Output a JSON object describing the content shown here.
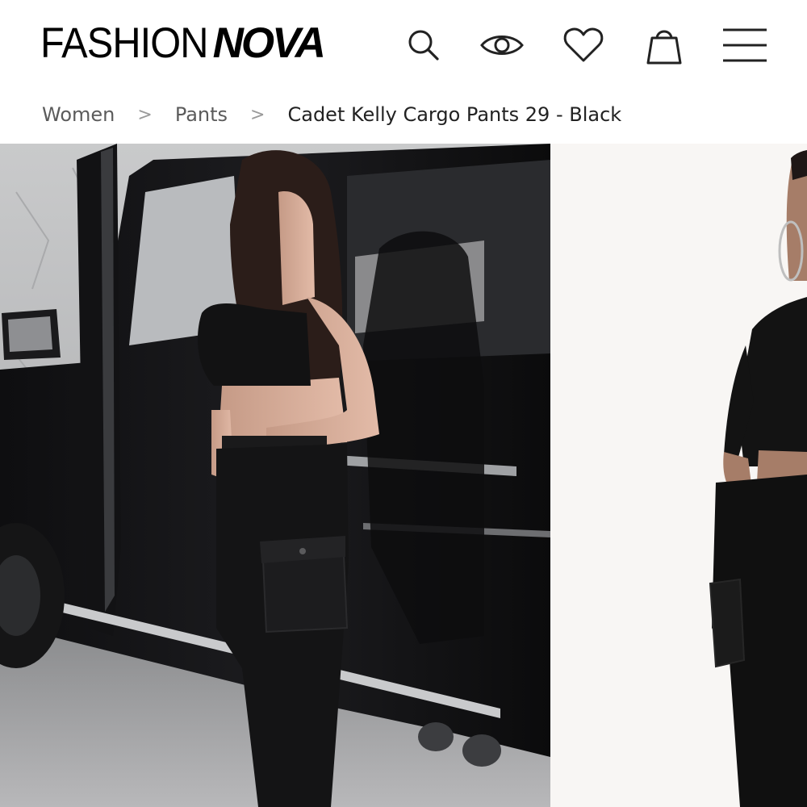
{
  "header": {
    "logo_light": "FASHION",
    "logo_bold": "NOVA",
    "icons": [
      "search-icon",
      "eye-icon",
      "heart-icon",
      "shopping-bag-icon",
      "menu-icon"
    ]
  },
  "breadcrumb": {
    "items": [
      "Women",
      "Pants",
      "Cadet Kelly Cargo Pants 29 - Black"
    ],
    "separator": ">"
  },
  "gallery": {
    "images": [
      "product-photo-main",
      "product-photo-secondary"
    ]
  }
}
